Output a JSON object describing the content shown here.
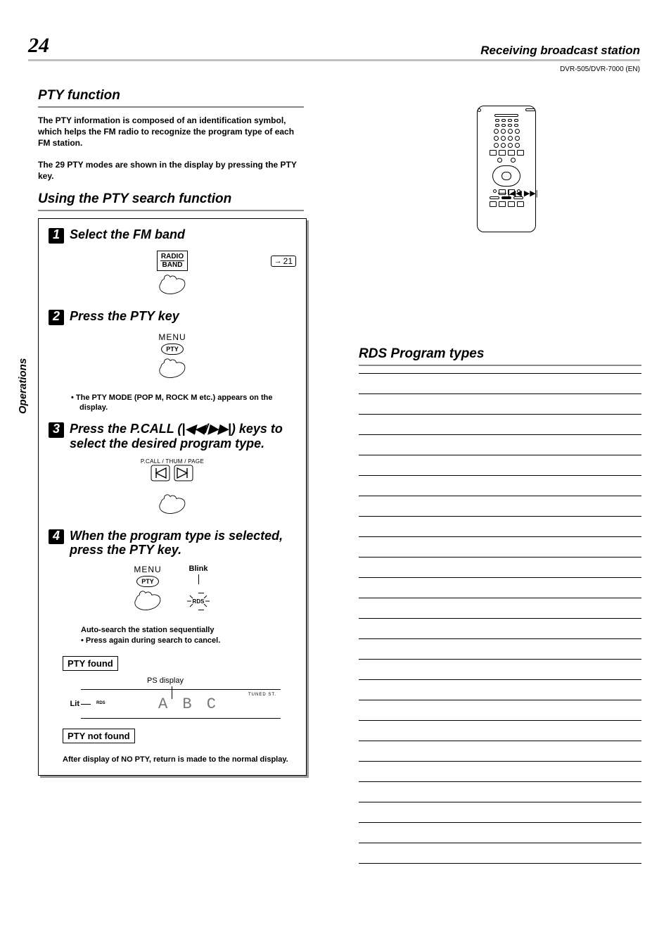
{
  "page_number": "24",
  "header_title": "Receiving broadcast station",
  "model_line": "DVR-505/DVR-7000 (EN)",
  "side_tab": "Operations",
  "section_pty": "PTY function",
  "intro_p1": "The PTY information is composed of an identification symbol, which helps the FM radio to recognize the program type of each FM station.",
  "intro_p2": "The 29 PTY modes are shown in the display by pressing the PTY key.",
  "section_using": "Using the PTY search function",
  "steps": {
    "s1": {
      "num": "1",
      "title": "Select the FM band",
      "ref": "21",
      "btn_top": "RADIO",
      "btn_bottom": "BAND"
    },
    "s2": {
      "num": "2",
      "title": "Press the PTY key",
      "menu": "MENU",
      "pty": "PTY",
      "note": "The PTY MODE (POP M, ROCK M etc.) appears on the display."
    },
    "s3": {
      "num": "3",
      "title_a": "Press the P.CALL (",
      "title_b": ") keys to select the desired program type.",
      "label": "P.CALL / THUM / PAGE"
    },
    "s4": {
      "num": "4",
      "title": "When the program type is selected, press the PTY key.",
      "menu": "MENU",
      "pty": "PTY",
      "blink": "Blink",
      "rds": "RDS",
      "auto": "Auto-search the station sequentially",
      "cancel": "Press again during search to cancel."
    }
  },
  "pty_found": "PTY found",
  "ps_display": "PS display",
  "lit": "Lit",
  "rds_mini": "RDS",
  "abc_display": "A B C",
  "tuned_st": "TUNED   ST.",
  "pty_not_found": "PTY not found",
  "after_not_found": "After display of NO PTY, return is made to the normal display.",
  "remote_skip": "|◀◀  ▶▶|",
  "rds_heading": "RDS Program types"
}
